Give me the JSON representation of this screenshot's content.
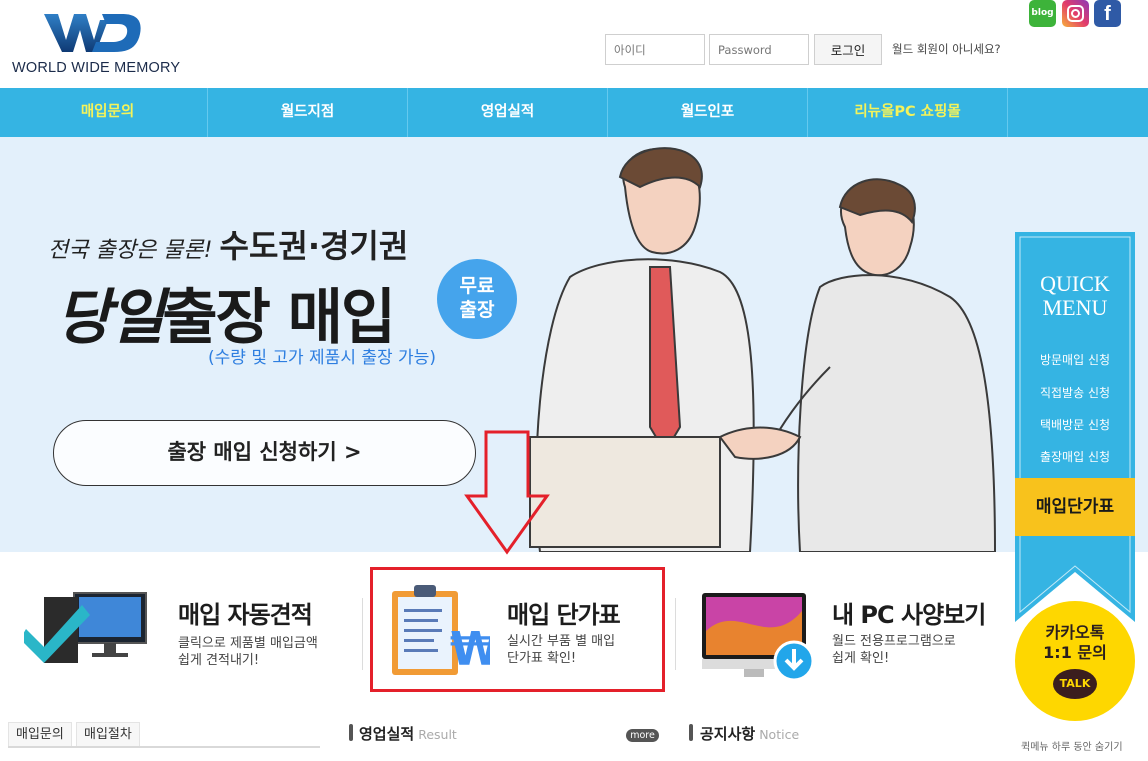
{
  "header": {
    "logo_text": "WORLD WIDE MEMORY",
    "login": {
      "id_placeholder": "아이디",
      "pw_placeholder": "Password",
      "login_button": "로그인",
      "join_text": "월드 회원이 아니세요?"
    }
  },
  "nav": {
    "items": [
      {
        "label": "매입문의",
        "highlight": true
      },
      {
        "label": "월드지점",
        "highlight": false
      },
      {
        "label": "영업실적",
        "highlight": false
      },
      {
        "label": "월드인포",
        "highlight": false
      },
      {
        "label": "리뉴올PC 쇼핑몰",
        "highlight": true
      }
    ],
    "color": "#35b4e3",
    "highlight_color": "#f4f35a"
  },
  "hero": {
    "line1_small": "전국 출장은 물론!",
    "line1_big": "수도권·경기권",
    "title_brush": "당일",
    "title": "출장 매입",
    "badge": "무료 출장",
    "badge_line1": "무료",
    "badge_line2": "출장",
    "subtitle": "(수량 및 고가 제품시 출장 가능)",
    "cta": "출장 매입 신청하기  >"
  },
  "features": [
    {
      "title": "매입 자동견적",
      "desc1": "클릭으로 제품별 매입금액",
      "desc2": "쉽게 견적내기!",
      "icon": "computer-check-icon"
    },
    {
      "title": "매입 단가표",
      "desc1": "실시간 부품 별 매입",
      "desc2": "단가표 확인!",
      "icon": "clipboard-won-icon"
    },
    {
      "title": "내 PC 사양보기",
      "desc1": "월드 전용프로그램으로",
      "desc2": "쉽게 확인!",
      "icon": "monitor-download-icon"
    }
  ],
  "bottom": {
    "tabs": [
      "매입문의",
      "매입절차"
    ],
    "results_title": "영업실적",
    "results_en": "Result",
    "more": "more",
    "notice_title": "공지사항",
    "notice_en": "Notice"
  },
  "quick_menu": {
    "sns": [
      "blog",
      "instagram",
      "facebook"
    ],
    "blog_label": "blog",
    "title_line1": "QUICK",
    "title_line2": "MENU",
    "items": [
      "방문매입 신청",
      "직접발송 신청",
      "택배방문 신청",
      "출장매입 신청"
    ],
    "price_button": "매입단가표",
    "kakao_line1": "카카오톡",
    "kakao_line2": "1:1 문의",
    "kakao_talk": "TALK",
    "hide_today": "퀵메뉴 하루 동안 숨기기",
    "color": "#35b4e3"
  }
}
